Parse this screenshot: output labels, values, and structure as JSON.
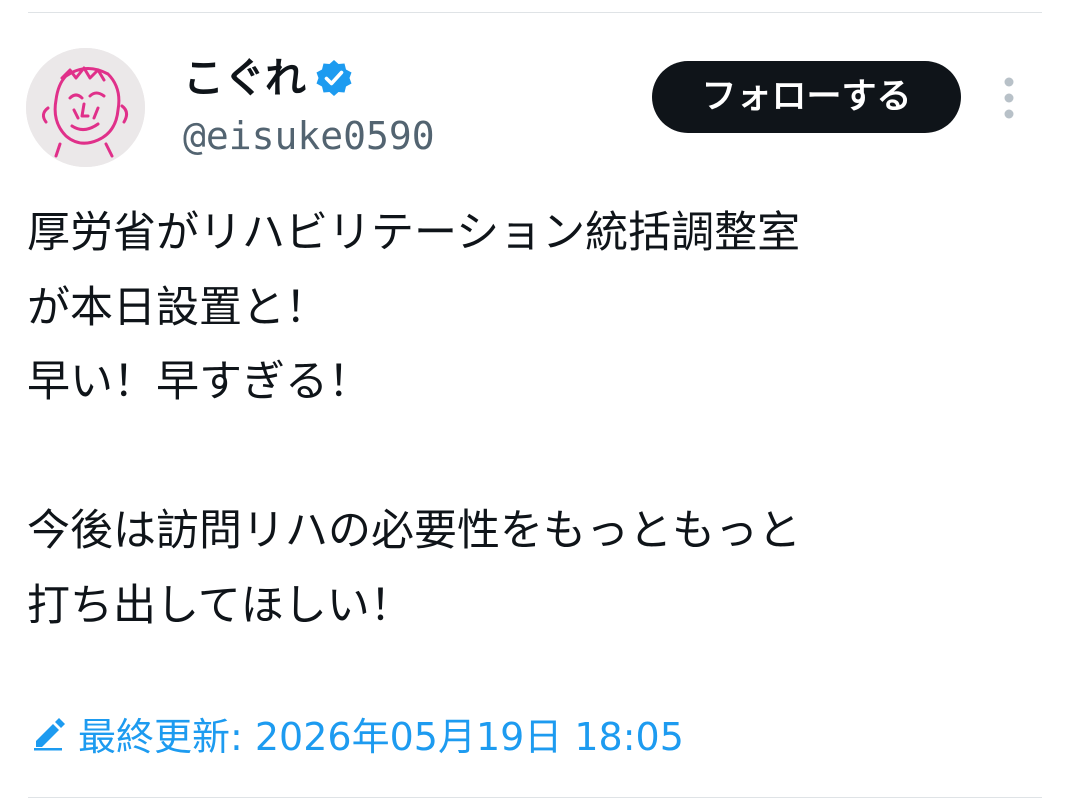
{
  "author": {
    "display_name": "こぐれ",
    "handle": "@eisuke0590",
    "verified": true,
    "avatar_icon": "handdrawn-face-avatar"
  },
  "actions": {
    "follow_label": "フォローする",
    "more_icon": "more-vertical-icon"
  },
  "tweet": {
    "lines": [
      "厚労省がリハビリテーション統括調整室",
      "が本日設置と！",
      "早い！早すぎる！",
      "",
      "今後は訪問リハの必要性をもっともっと",
      "打ち出してほしい！"
    ]
  },
  "edited": {
    "icon": "pencil-icon",
    "label": "最終更新: 2026年05月19日 18:05"
  },
  "colors": {
    "accent": "#1d9bf0",
    "text": "#0f1419",
    "secondary": "#536471",
    "button_bg": "#0f1419"
  }
}
